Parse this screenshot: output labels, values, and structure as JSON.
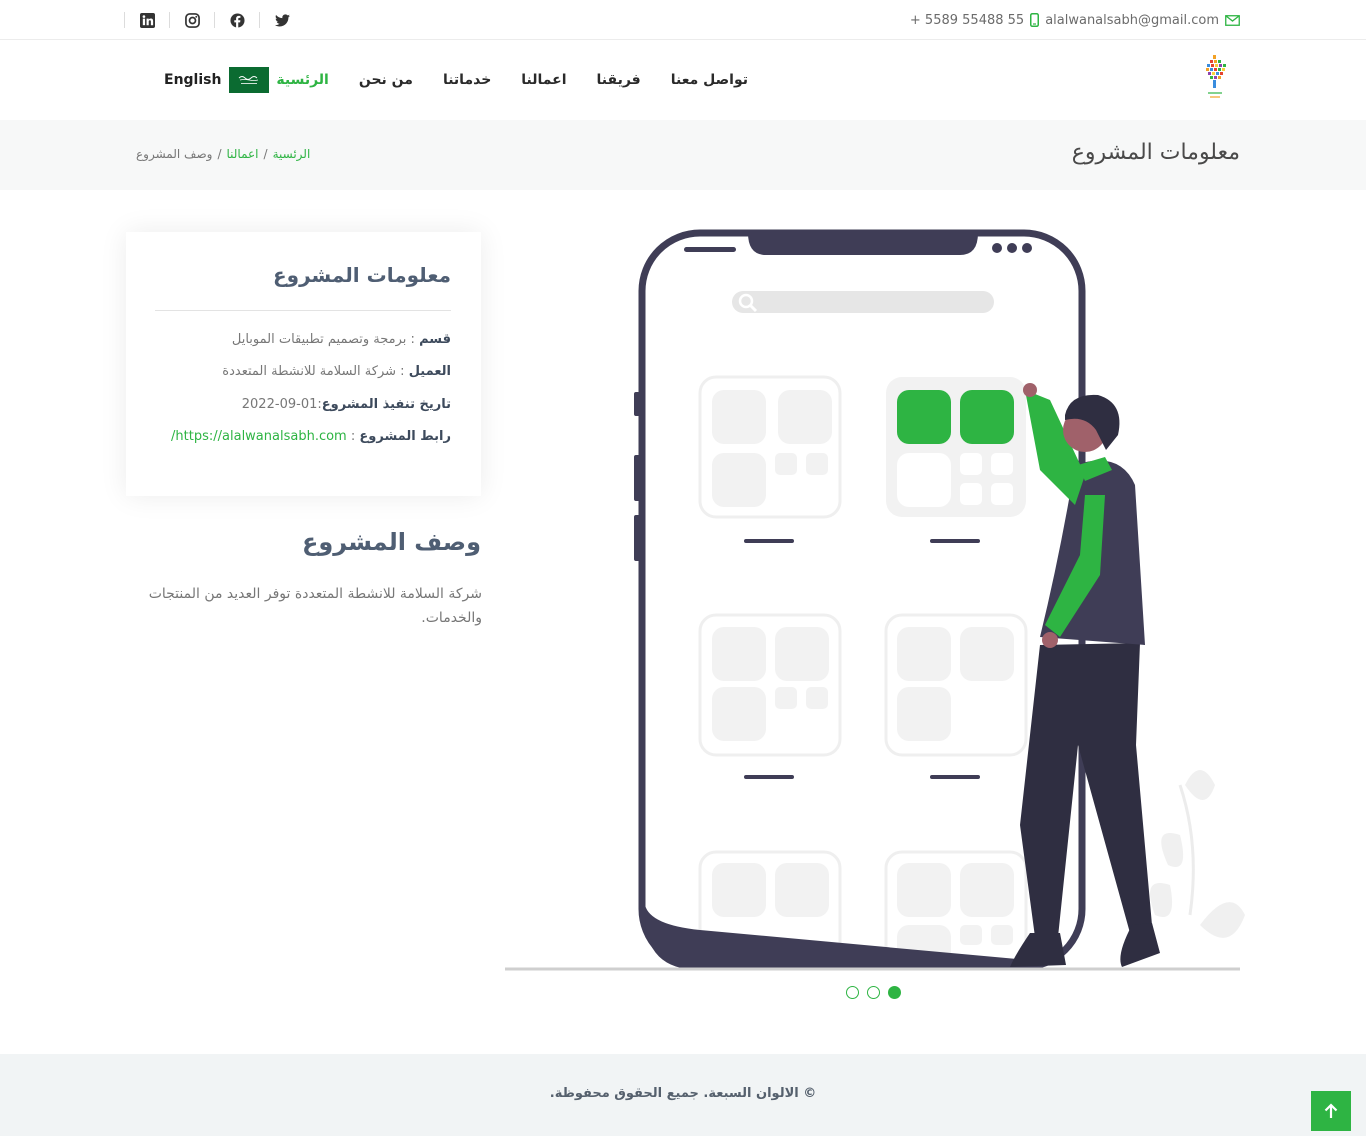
{
  "topbar": {
    "email": "alalwanalsabh@gmail.com",
    "phone": "+ 5589 55488 55",
    "socials": [
      "linkedin-icon",
      "instagram-icon",
      "facebook-icon",
      "twitter-icon"
    ]
  },
  "nav": {
    "items": [
      {
        "label": "الرئسية",
        "active": true
      },
      {
        "label": "من نحن"
      },
      {
        "label": "خدماتنا"
      },
      {
        "label": "اعمالنا"
      },
      {
        "label": "فريقنا"
      },
      {
        "label": "تواصل معنا"
      }
    ],
    "language": "English"
  },
  "page_header": {
    "title": "معلومات المشروع",
    "breadcrumb": {
      "home": "الرئسية",
      "works": "اعمالنا",
      "current": "وصف المشروع"
    }
  },
  "info_card": {
    "title": "معلومات المشروع",
    "category_label": "قسم",
    "category_value": "برمجة وتصميم تطبيقات الموبايل",
    "client_label": "العميل",
    "client_value": "شركة السلامة للانشطة المتعددة",
    "date_label": "تاريخ تنفيذ المشروع",
    "date_value": "01-09-2022",
    "link_label": "رابط المشروع",
    "link_value": "https://alalwanalsabh.com/"
  },
  "description": {
    "title": "وصف المشروع",
    "text": "شركة السلامة للانشطة المتعددة توفر العديد من المنتجات والخدمات."
  },
  "slider": {
    "count": 3,
    "active_index": 2
  },
  "footer": {
    "copyright": "© الالوان السبعة. جميع الحقوق محفوظة."
  },
  "colors": {
    "accent": "#2eb443",
    "heading": "#4f5e73",
    "text": "#777777",
    "phone_dark": "#3f3d56"
  }
}
